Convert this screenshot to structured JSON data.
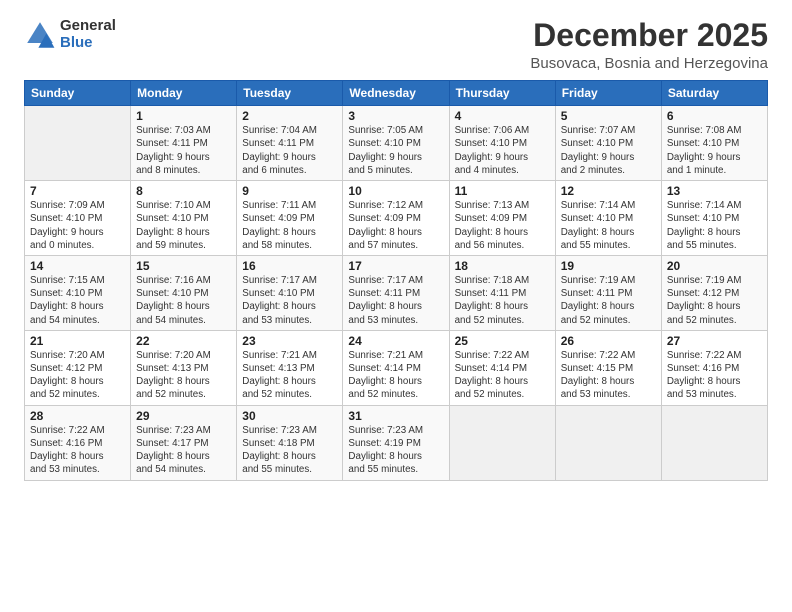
{
  "logo": {
    "general": "General",
    "blue": "Blue"
  },
  "title": "December 2025",
  "subtitle": "Busovaca, Bosnia and Herzegovina",
  "header_days": [
    "Sunday",
    "Monday",
    "Tuesday",
    "Wednesday",
    "Thursday",
    "Friday",
    "Saturday"
  ],
  "weeks": [
    [
      {
        "day": "",
        "info": ""
      },
      {
        "day": "1",
        "info": "Sunrise: 7:03 AM\nSunset: 4:11 PM\nDaylight: 9 hours\nand 8 minutes."
      },
      {
        "day": "2",
        "info": "Sunrise: 7:04 AM\nSunset: 4:11 PM\nDaylight: 9 hours\nand 6 minutes."
      },
      {
        "day": "3",
        "info": "Sunrise: 7:05 AM\nSunset: 4:10 PM\nDaylight: 9 hours\nand 5 minutes."
      },
      {
        "day": "4",
        "info": "Sunrise: 7:06 AM\nSunset: 4:10 PM\nDaylight: 9 hours\nand 4 minutes."
      },
      {
        "day": "5",
        "info": "Sunrise: 7:07 AM\nSunset: 4:10 PM\nDaylight: 9 hours\nand 2 minutes."
      },
      {
        "day": "6",
        "info": "Sunrise: 7:08 AM\nSunset: 4:10 PM\nDaylight: 9 hours\nand 1 minute."
      }
    ],
    [
      {
        "day": "7",
        "info": "Sunrise: 7:09 AM\nSunset: 4:10 PM\nDaylight: 9 hours\nand 0 minutes."
      },
      {
        "day": "8",
        "info": "Sunrise: 7:10 AM\nSunset: 4:10 PM\nDaylight: 8 hours\nand 59 minutes."
      },
      {
        "day": "9",
        "info": "Sunrise: 7:11 AM\nSunset: 4:09 PM\nDaylight: 8 hours\nand 58 minutes."
      },
      {
        "day": "10",
        "info": "Sunrise: 7:12 AM\nSunset: 4:09 PM\nDaylight: 8 hours\nand 57 minutes."
      },
      {
        "day": "11",
        "info": "Sunrise: 7:13 AM\nSunset: 4:09 PM\nDaylight: 8 hours\nand 56 minutes."
      },
      {
        "day": "12",
        "info": "Sunrise: 7:14 AM\nSunset: 4:10 PM\nDaylight: 8 hours\nand 55 minutes."
      },
      {
        "day": "13",
        "info": "Sunrise: 7:14 AM\nSunset: 4:10 PM\nDaylight: 8 hours\nand 55 minutes."
      }
    ],
    [
      {
        "day": "14",
        "info": "Sunrise: 7:15 AM\nSunset: 4:10 PM\nDaylight: 8 hours\nand 54 minutes."
      },
      {
        "day": "15",
        "info": "Sunrise: 7:16 AM\nSunset: 4:10 PM\nDaylight: 8 hours\nand 54 minutes."
      },
      {
        "day": "16",
        "info": "Sunrise: 7:17 AM\nSunset: 4:10 PM\nDaylight: 8 hours\nand 53 minutes."
      },
      {
        "day": "17",
        "info": "Sunrise: 7:17 AM\nSunset: 4:11 PM\nDaylight: 8 hours\nand 53 minutes."
      },
      {
        "day": "18",
        "info": "Sunrise: 7:18 AM\nSunset: 4:11 PM\nDaylight: 8 hours\nand 52 minutes."
      },
      {
        "day": "19",
        "info": "Sunrise: 7:19 AM\nSunset: 4:11 PM\nDaylight: 8 hours\nand 52 minutes."
      },
      {
        "day": "20",
        "info": "Sunrise: 7:19 AM\nSunset: 4:12 PM\nDaylight: 8 hours\nand 52 minutes."
      }
    ],
    [
      {
        "day": "21",
        "info": "Sunrise: 7:20 AM\nSunset: 4:12 PM\nDaylight: 8 hours\nand 52 minutes."
      },
      {
        "day": "22",
        "info": "Sunrise: 7:20 AM\nSunset: 4:13 PM\nDaylight: 8 hours\nand 52 minutes."
      },
      {
        "day": "23",
        "info": "Sunrise: 7:21 AM\nSunset: 4:13 PM\nDaylight: 8 hours\nand 52 minutes."
      },
      {
        "day": "24",
        "info": "Sunrise: 7:21 AM\nSunset: 4:14 PM\nDaylight: 8 hours\nand 52 minutes."
      },
      {
        "day": "25",
        "info": "Sunrise: 7:22 AM\nSunset: 4:14 PM\nDaylight: 8 hours\nand 52 minutes."
      },
      {
        "day": "26",
        "info": "Sunrise: 7:22 AM\nSunset: 4:15 PM\nDaylight: 8 hours\nand 53 minutes."
      },
      {
        "day": "27",
        "info": "Sunrise: 7:22 AM\nSunset: 4:16 PM\nDaylight: 8 hours\nand 53 minutes."
      }
    ],
    [
      {
        "day": "28",
        "info": "Sunrise: 7:22 AM\nSunset: 4:16 PM\nDaylight: 8 hours\nand 53 minutes."
      },
      {
        "day": "29",
        "info": "Sunrise: 7:23 AM\nSunset: 4:17 PM\nDaylight: 8 hours\nand 54 minutes."
      },
      {
        "day": "30",
        "info": "Sunrise: 7:23 AM\nSunset: 4:18 PM\nDaylight: 8 hours\nand 55 minutes."
      },
      {
        "day": "31",
        "info": "Sunrise: 7:23 AM\nSunset: 4:19 PM\nDaylight: 8 hours\nand 55 minutes."
      },
      {
        "day": "",
        "info": ""
      },
      {
        "day": "",
        "info": ""
      },
      {
        "day": "",
        "info": ""
      }
    ]
  ]
}
